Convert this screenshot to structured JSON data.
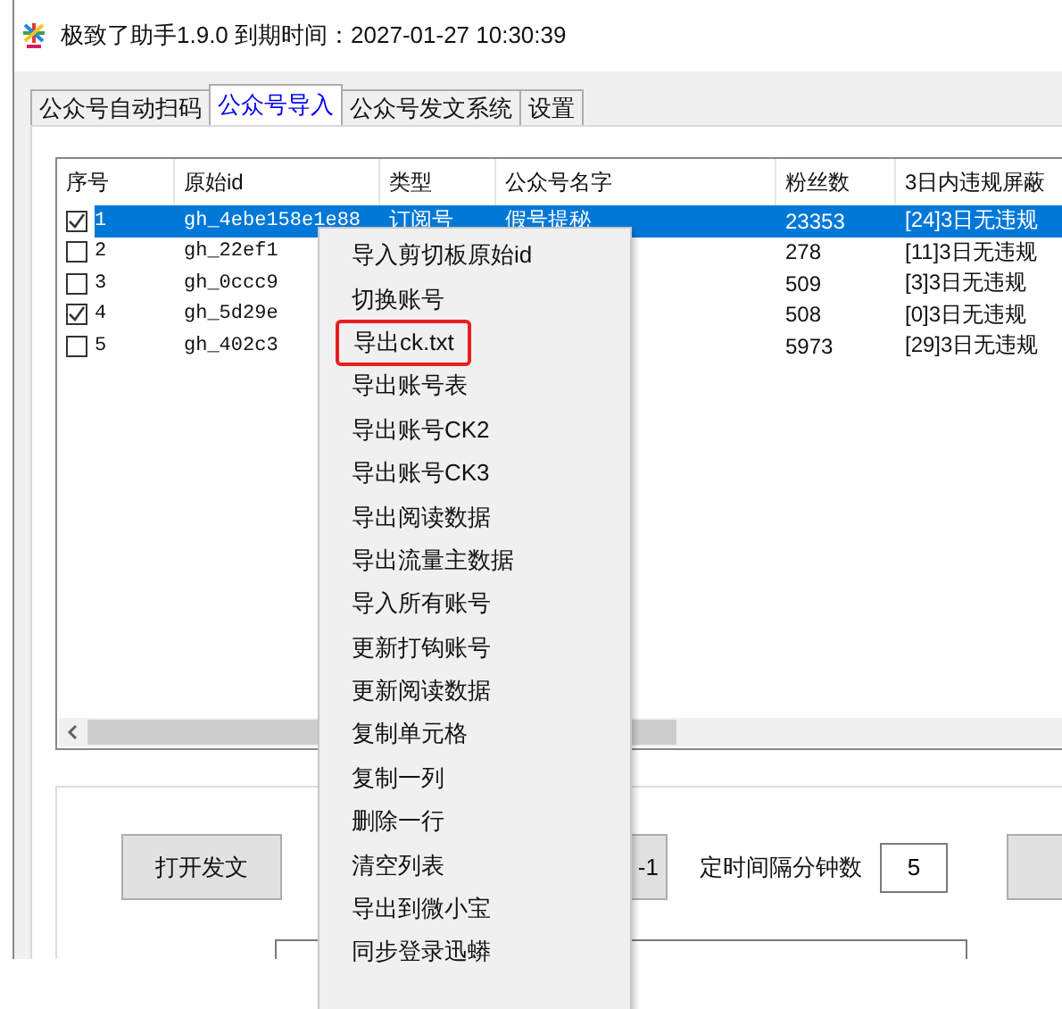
{
  "window": {
    "title": "极致了助手1.9.0  到期时间：2027-01-27 10:30:39"
  },
  "tabs": [
    {
      "label": "公众号自动扫码",
      "selected": false
    },
    {
      "label": "公众号导入",
      "selected": true
    },
    {
      "label": "公众号发文系统",
      "selected": false
    },
    {
      "label": "设置",
      "selected": false
    }
  ],
  "table": {
    "columns": [
      "序号",
      "原始id",
      "类型",
      "公众号名字",
      "粉丝数",
      "3日内违规屏蔽"
    ],
    "rows": [
      {
        "checked": true,
        "selected": true,
        "number": "1",
        "id": "gh_4ebe158e1e88",
        "type": "订阅号",
        "name": "假号提秘",
        "fans": "23353",
        "violation": "[24]3日无违规"
      },
      {
        "checked": false,
        "selected": false,
        "number": "2",
        "id": "gh_22ef1",
        "fans": "278",
        "violation": "[11]3日无违规"
      },
      {
        "checked": false,
        "selected": false,
        "number": "3",
        "id": "gh_0ccc9",
        "fans": "509",
        "violation": "[3]3日无违规"
      },
      {
        "checked": true,
        "selected": false,
        "number": "4",
        "id": "gh_5d29e",
        "fans": "508",
        "violation": "[0]3日无违规"
      },
      {
        "checked": false,
        "selected": false,
        "number": "5",
        "id": "gh_402c3",
        "fans": "5973",
        "violation": "[29]3日无违规"
      }
    ]
  },
  "context_menu": {
    "items": [
      {
        "label": "导入剪切板原始id",
        "highlighted": false
      },
      {
        "label": "切换账号",
        "highlighted": false
      },
      {
        "label": "导出ck.txt",
        "highlighted": true
      },
      {
        "label": "导出账号表",
        "highlighted": false
      },
      {
        "label": "导出账号CK2",
        "highlighted": false
      },
      {
        "label": "导出账号CK3",
        "highlighted": false
      },
      {
        "label": "导出阅读数据",
        "highlighted": false
      },
      {
        "label": "导出流量主数据",
        "highlighted": false
      },
      {
        "label": "导入所有账号",
        "highlighted": false
      },
      {
        "label": "更新打钩账号",
        "highlighted": false
      },
      {
        "label": "更新阅读数据",
        "highlighted": false
      },
      {
        "label": "复制单元格",
        "highlighted": false
      },
      {
        "label": "复制一列",
        "highlighted": false
      },
      {
        "label": "删除一行",
        "highlighted": false
      },
      {
        "label": "清空列表",
        "highlighted": false
      },
      {
        "label": "导出到微小宝",
        "highlighted": false
      },
      {
        "label": "同步登录迅蟒",
        "highlighted": false
      }
    ]
  },
  "controls": {
    "open_button": "打开发文",
    "minus_button": "-1",
    "interval_label": "定时间隔分钟数",
    "interval_value": "5"
  }
}
